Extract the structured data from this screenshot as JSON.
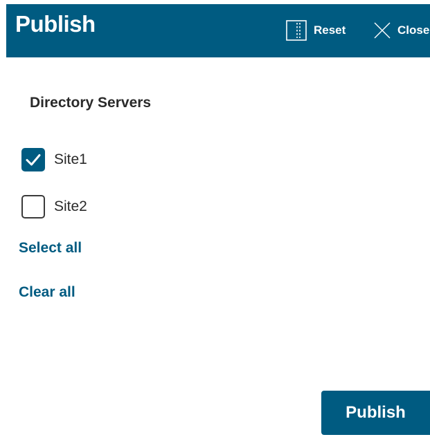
{
  "header": {
    "title": "Publish",
    "reset_label": "Reset",
    "close_label": "Close",
    "background_color": "#005b81"
  },
  "section": {
    "title": "Directory Servers"
  },
  "sites": [
    {
      "label": "Site1",
      "checked": true
    },
    {
      "label": "Site2",
      "checked": false
    }
  ],
  "links": {
    "select_all": "Select all",
    "clear_all": "Clear all"
  },
  "footer": {
    "publish_label": "Publish"
  },
  "icons": {
    "reset": "reset-icon",
    "close": "close-icon",
    "check": "check-icon"
  }
}
